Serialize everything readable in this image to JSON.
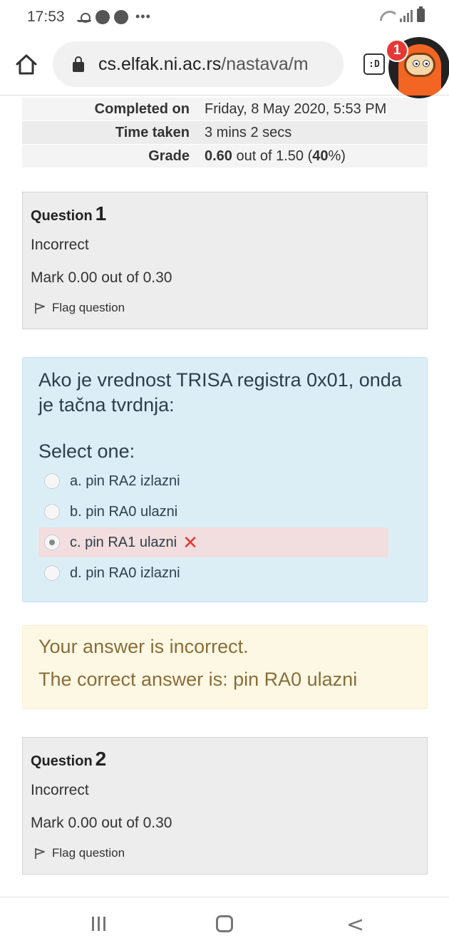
{
  "status_bar": {
    "time": "17:53",
    "dots": "•••",
    "icons": [
      "weather-icon",
      "messenger-icon",
      "messenger-icon"
    ]
  },
  "browser": {
    "url_host": "cs.elfak.ni.ac.rs",
    "url_path": "/nastava/m",
    "reader_label": ":D",
    "notification_count": "1"
  },
  "summary": {
    "rows": [
      {
        "label": "Completed on",
        "value": "Friday, 8 May 2020, 5:53 PM"
      },
      {
        "label": "Time taken",
        "value": "3 mins 2 secs"
      },
      {
        "label": "Grade",
        "value_bold1": "0.60",
        "value_mid": " out of 1.50 (",
        "value_bold2": "40",
        "value_end": "%)"
      }
    ]
  },
  "questions": [
    {
      "label": "Question",
      "number": "1",
      "state": "Incorrect",
      "mark": "Mark 0.00 out of 0.30",
      "flag_label": "Flag question"
    },
    {
      "label": "Question",
      "number": "2",
      "state": "Incorrect",
      "mark": "Mark 0.00 out of 0.30",
      "flag_label": "Flag question"
    }
  ],
  "question1_content": {
    "text": "Ako je vrednost TRISA registra 0x01, onda je tačna tvrdnja:",
    "prompt": "Select one:",
    "options": [
      {
        "label": "a. pin RA2 izlazni",
        "checked": false
      },
      {
        "label": "b. pin RA0 ulazni",
        "checked": false
      },
      {
        "label": "c. pin RA1 ulazni",
        "checked": true,
        "wrong": true
      },
      {
        "label": "d. pin RA0 izlazni",
        "checked": false
      }
    ],
    "wrong_mark": "✕"
  },
  "feedback": {
    "line1": "Your answer is incorrect.",
    "line2": "The correct answer is: pin RA0 ulazni"
  },
  "nav": {
    "back_glyph": "<"
  }
}
